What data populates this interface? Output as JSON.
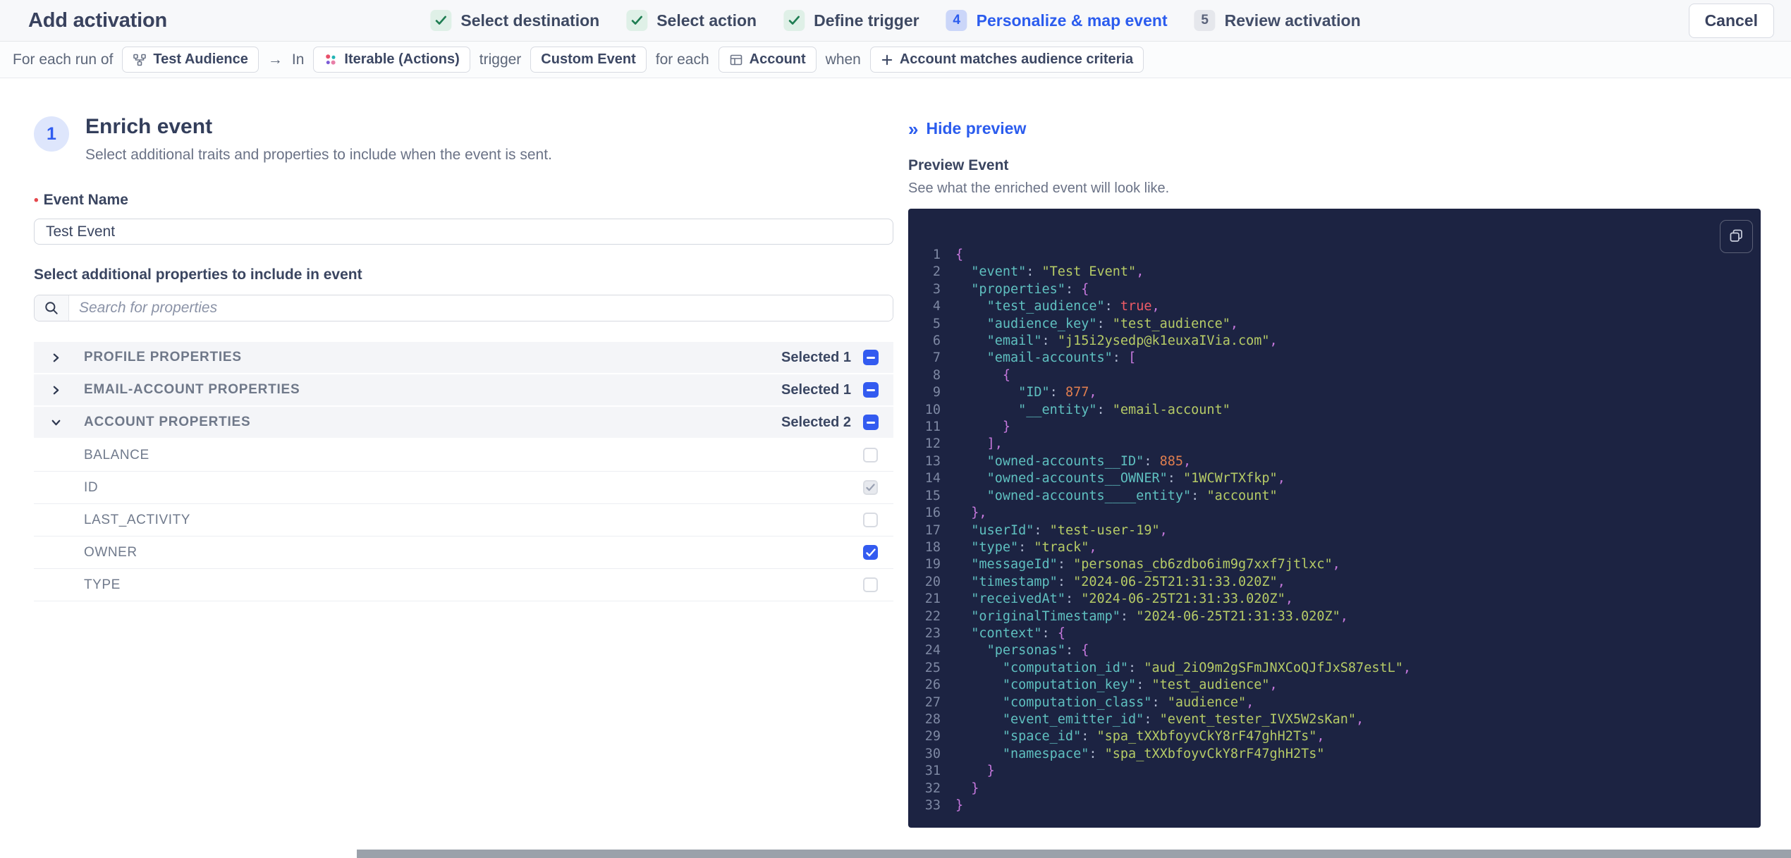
{
  "header": {
    "title": "Add activation",
    "cancel_label": "Cancel",
    "steps": [
      {
        "label": "Select destination",
        "status": "done"
      },
      {
        "label": "Select action",
        "status": "done"
      },
      {
        "label": "Define trigger",
        "status": "done"
      },
      {
        "label": "Personalize & map event",
        "status": "active",
        "number": "4"
      },
      {
        "label": "Review activation",
        "status": "upcoming",
        "number": "5"
      }
    ]
  },
  "context_bar": {
    "items": [
      {
        "kind": "text",
        "label": "For each run of"
      },
      {
        "kind": "chip",
        "name": "chip-test-audience",
        "icon": "audience-icon",
        "label": "Test Audience"
      },
      {
        "kind": "text",
        "label": "→"
      },
      {
        "kind": "text",
        "label": "In"
      },
      {
        "kind": "chip",
        "name": "chip-destination-iterable",
        "icon": "iterable-icon",
        "label": "Iterable (Actions)"
      },
      {
        "kind": "text",
        "label": "trigger"
      },
      {
        "kind": "chip",
        "name": "chip-custom-event",
        "label": "Custom Event"
      },
      {
        "kind": "text",
        "label": "for each"
      },
      {
        "kind": "chip",
        "name": "chip-account-entity",
        "icon": "table-icon",
        "label": "Account"
      },
      {
        "kind": "text",
        "label": "when"
      },
      {
        "kind": "chip",
        "name": "chip-audience-criteria",
        "icon": "plus-icon",
        "label": "Account matches audience criteria"
      }
    ]
  },
  "enrich": {
    "step_number": "1",
    "title": "Enrich event",
    "subtitle": "Select additional traits and properties to include when the event is sent.",
    "event_name": {
      "required_marker": "•",
      "label": "Event Name",
      "value": "Test Event"
    },
    "properties_label": "Select additional properties to include in event",
    "search": {
      "placeholder": "Search for properties"
    },
    "groups": [
      {
        "label": "PROFILE PROPERTIES",
        "selected_label": "Selected 1",
        "state": "indeterminate",
        "expanded": false
      },
      {
        "label": "EMAIL-ACCOUNT PROPERTIES",
        "selected_label": "Selected 1",
        "state": "indeterminate",
        "expanded": false
      },
      {
        "label": "ACCOUNT PROPERTIES",
        "selected_label": "Selected 2",
        "state": "indeterminate",
        "expanded": true,
        "rows": [
          {
            "label": "BALANCE",
            "state": "unchecked"
          },
          {
            "label": "ID",
            "state": "checked-disabled"
          },
          {
            "label": "LAST_ACTIVITY",
            "state": "unchecked"
          },
          {
            "label": "OWNER",
            "state": "checked"
          },
          {
            "label": "TYPE",
            "state": "unchecked"
          }
        ]
      }
    ]
  },
  "preview": {
    "hide_icon": "»",
    "hide_label": "Hide preview",
    "title": "Preview Event",
    "subtitle": "See what the enriched event will look like.",
    "code_lines": [
      "{",
      "  \"event\": \"Test Event\",",
      "  \"properties\": {",
      "    \"test_audience\": true,",
      "    \"audience_key\": \"test_audience\",",
      "    \"email\": \"j15i2ysedp@k1euxaIVia.com\",",
      "    \"email-accounts\": [",
      "      {",
      "        \"ID\": 877,",
      "        \"__entity\": \"email-account\"",
      "      }",
      "    ],",
      "    \"owned-accounts__ID\": 885,",
      "    \"owned-accounts__OWNER\": \"1WCWrTXfkp\",",
      "    \"owned-accounts____entity\": \"account\"",
      "  },",
      "  \"userId\": \"test-user-19\",",
      "  \"type\": \"track\",",
      "  \"messageId\": \"personas_cb6zdbo6im9g7xxf7jtlxc\",",
      "  \"timestamp\": \"2024-06-25T21:31:33.020Z\",",
      "  \"receivedAt\": \"2024-06-25T21:31:33.020Z\",",
      "  \"originalTimestamp\": \"2024-06-25T21:31:33.020Z\",",
      "  \"context\": {",
      "    \"personas\": {",
      "      \"computation_id\": \"aud_2iO9m2gSFmJNXCoQJfJxS87estL\",",
      "      \"computation_key\": \"test_audience\",",
      "      \"computation_class\": \"audience\",",
      "      \"event_emitter_id\": \"event_tester_IVX5W2sKan\",",
      "      \"space_id\": \"spa_tXXbfoyvCkY8rF47ghH2Ts\",",
      "      \"namespace\": \"spa_tXXbfoyvCkY8rF47ghH2Ts\"",
      "    }",
      "  }",
      "}"
    ]
  },
  "colors": {
    "accent_blue": "#2B5CEE",
    "success_green": "#1E7D52",
    "required_red": "#E5484D",
    "code_bg": "#1C2342",
    "code_key": "#5FC0C0",
    "code_string": "#B6CB66",
    "code_number": "#E07E4F",
    "code_boolean": "#EF5B66",
    "code_brace": "#C678DD"
  }
}
